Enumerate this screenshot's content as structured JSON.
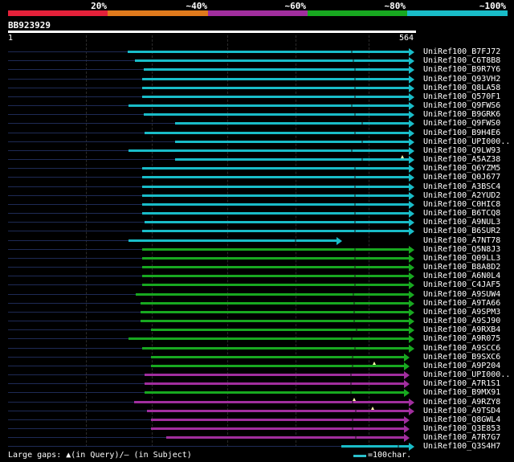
{
  "colors": {
    "background": "#000000",
    "level_20": "#e4213a",
    "level_40": "#e07a1c",
    "level_60": "#a12e9e",
    "level_80": "#18a820",
    "level_100": "#19bcc8",
    "query_line": "#ffffff",
    "gap_marker": "#ffffaa"
  },
  "identity_scale": [
    {
      "label": "20%",
      "color": "#e4213a"
    },
    {
      "label": "~40%",
      "color": "#e07a1c"
    },
    {
      "label": "~60%",
      "color": "#a12e9e"
    },
    {
      "label": "~80%",
      "color": "#18a820"
    },
    {
      "label": "~100%",
      "color": "#19bcc8"
    }
  ],
  "query": {
    "name": "BB923929",
    "start": "1",
    "end": "564"
  },
  "hits": [
    {
      "name": "UniRef100_B7FJ72",
      "color": "#19bcc8",
      "start": 167,
      "end": 564
    },
    {
      "name": "UniRef100_C6T8B8",
      "color": "#19bcc8",
      "start": 177,
      "end": 564
    },
    {
      "name": "UniRef100_B9R7Y6",
      "color": "#19bcc8",
      "start": 189,
      "end": 564
    },
    {
      "name": "UniRef100_Q93VH2",
      "color": "#19bcc8",
      "start": 187,
      "end": 564
    },
    {
      "name": "UniRef100_Q8LA58",
      "color": "#19bcc8",
      "start": 187,
      "end": 564
    },
    {
      "name": "UniRef100_Q570F1",
      "color": "#19bcc8",
      "start": 187,
      "end": 564
    },
    {
      "name": "UniRef100_Q9FWS6",
      "color": "#19bcc8",
      "start": 168,
      "end": 564
    },
    {
      "name": "UniRef100_B9GRK6",
      "color": "#19bcc8",
      "start": 189,
      "end": 564
    },
    {
      "name": "UniRef100_Q9FWS0",
      "color": "#19bcc8",
      "start": 233,
      "end": 564
    },
    {
      "name": "UniRef100_B9H4E6",
      "color": "#19bcc8",
      "start": 190,
      "end": 564
    },
    {
      "name": "UniRef100_UPI000..",
      "color": "#19bcc8",
      "start": 233,
      "end": 564
    },
    {
      "name": "UniRef100_Q9LW93",
      "color": "#19bcc8",
      "start": 168,
      "end": 564
    },
    {
      "name": "UniRef100_A5AZ38",
      "color": "#19bcc8",
      "start": 233,
      "end": 564,
      "tri": 548
    },
    {
      "name": "UniRef100_Q6YZM5",
      "color": "#19bcc8",
      "start": 187,
      "end": 564
    },
    {
      "name": "UniRef100_Q0J677",
      "color": "#19bcc8",
      "start": 187,
      "end": 564
    },
    {
      "name": "UniRef100_A3BSC4",
      "color": "#19bcc8",
      "start": 187,
      "end": 564
    },
    {
      "name": "UniRef100_A2YUD2",
      "color": "#19bcc8",
      "start": 187,
      "end": 564
    },
    {
      "name": "UniRef100_C0HIC8",
      "color": "#19bcc8",
      "start": 187,
      "end": 564
    },
    {
      "name": "UniRef100_B6TCQ8",
      "color": "#19bcc8",
      "start": 187,
      "end": 564
    },
    {
      "name": "UniRef100_A9NUL3",
      "color": "#19bcc8",
      "start": 190,
      "end": 564
    },
    {
      "name": "UniRef100_B6SUR2",
      "color": "#19bcc8",
      "start": 187,
      "end": 564
    },
    {
      "name": "UniRef100_A7NT78",
      "color": "#19bcc8",
      "start": 168,
      "end": 464
    },
    {
      "name": "UniRef100_Q5N8J3",
      "color": "#18a820",
      "start": 187,
      "end": 564
    },
    {
      "name": "UniRef100_Q09LL3",
      "color": "#18a820",
      "start": 187,
      "end": 564
    },
    {
      "name": "UniRef100_B8A8D2",
      "color": "#18a820",
      "start": 187,
      "end": 564
    },
    {
      "name": "UniRef100_A6N0L4",
      "color": "#18a820",
      "start": 187,
      "end": 564
    },
    {
      "name": "UniRef100_C4JAF5",
      "color": "#18a820",
      "start": 187,
      "end": 564
    },
    {
      "name": "UniRef100_A9SUW4",
      "color": "#18a820",
      "start": 178,
      "end": 564
    },
    {
      "name": "UniRef100_A9TA66",
      "color": "#18a820",
      "start": 185,
      "end": 564
    },
    {
      "name": "UniRef100_A9SPM3",
      "color": "#18a820",
      "start": 185,
      "end": 564
    },
    {
      "name": "UniRef100_A9SJ90",
      "color": "#18a820",
      "start": 185,
      "end": 564
    },
    {
      "name": "UniRef100_A9RXB4",
      "color": "#18a820",
      "start": 199,
      "end": 564
    },
    {
      "name": "UniRef100_A9R075",
      "color": "#18a820",
      "start": 168,
      "end": 564
    },
    {
      "name": "UniRef100_A9SCC6",
      "color": "#18a820",
      "start": 187,
      "end": 564
    },
    {
      "name": "UniRef100_B9SXC6",
      "color": "#18a820",
      "start": 199,
      "end": 557
    },
    {
      "name": "UniRef100_A9P204",
      "color": "#18a820",
      "start": 199,
      "end": 557,
      "tri": 509
    },
    {
      "name": "UniRef100_UPI000..",
      "color": "#a12e9e",
      "start": 190,
      "end": 557
    },
    {
      "name": "UniRef100_A7R1S1",
      "color": "#a12e9e",
      "start": 190,
      "end": 557
    },
    {
      "name": "UniRef100_B9MX91",
      "color": "#18a820",
      "start": 190,
      "end": 557
    },
    {
      "name": "UniRef100_A9RZY8",
      "color": "#a12e9e",
      "start": 176,
      "end": 564,
      "tri": 482
    },
    {
      "name": "UniRef100_A9TSD4",
      "color": "#a12e9e",
      "start": 194,
      "end": 564,
      "tri": 507
    },
    {
      "name": "UniRef100_Q8GWL4",
      "color": "#a12e9e",
      "start": 199,
      "end": 557
    },
    {
      "name": "UniRef100_Q3E853",
      "color": "#a12e9e",
      "start": 199,
      "end": 557
    },
    {
      "name": "UniRef100_A7R7G7",
      "color": "#a12e9e",
      "start": 221,
      "end": 557
    },
    {
      "name": "UniRef100_Q3S4H7",
      "color": "#19bcc8",
      "start": 464,
      "end": 564
    }
  ],
  "footer": {
    "gaps_text": "Large gaps: ▲(in Query)/– (in Subject)",
    "legend_text": "=100char."
  }
}
